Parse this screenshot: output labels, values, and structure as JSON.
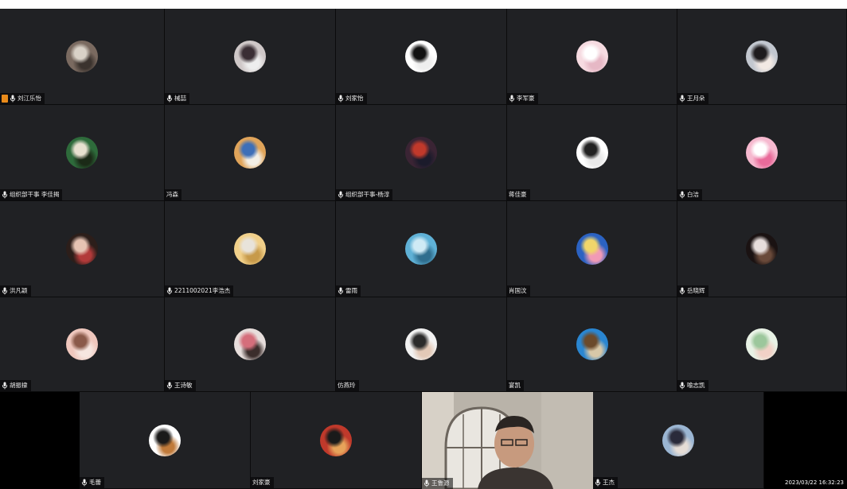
{
  "window": {
    "title": ""
  },
  "participants": [
    {
      "name": "刘江乐怡",
      "mic": true,
      "host": true,
      "avatar_colors": [
        "#7a6a60",
        "#d9d2c8",
        "#3b332e"
      ]
    },
    {
      "name": "械喆",
      "mic": true,
      "host": false,
      "avatar_colors": [
        "#cfc8c8",
        "#3a2e34",
        "#eee"
      ]
    },
    {
      "name": "刘家怡",
      "mic": true,
      "host": false,
      "avatar_colors": [
        "#ffffff",
        "#111111",
        "#eeeeee"
      ]
    },
    {
      "name": "李军豪",
      "mic": true,
      "host": false,
      "avatar_colors": [
        "#f6dbe1",
        "#ffffff",
        "#e6b8c5"
      ]
    },
    {
      "name": "王月朵",
      "mic": true,
      "host": false,
      "avatar_colors": [
        "#c2c7cf",
        "#1e1b1d",
        "#f2e9e4"
      ]
    },
    {
      "name": "组织部干事 李佳揭",
      "mic": true,
      "host": false,
      "avatar_colors": [
        "#2e6b3b",
        "#e8e1d0",
        "#1b2a17"
      ]
    },
    {
      "name": "冯森",
      "mic": false,
      "host": false,
      "avatar_colors": [
        "#e0a45a",
        "#3e6fb8",
        "#f3efe6"
      ]
    },
    {
      "name": "组织部干事-杨淳",
      "mic": true,
      "host": false,
      "avatar_colors": [
        "#3a2434",
        "#c0392b",
        "#1b1b2b"
      ]
    },
    {
      "name": "蒋佳豪",
      "mic": false,
      "host": false,
      "avatar_colors": [
        "#ffffff",
        "#222222",
        "#e9e9e9"
      ]
    },
    {
      "name": "白洁",
      "mic": true,
      "host": false,
      "avatar_colors": [
        "#f6b9cf",
        "#ffffff",
        "#e96b9a"
      ]
    },
    {
      "name": "洪凡颖",
      "mic": true,
      "host": false,
      "avatar_colors": [
        "#2c1e1a",
        "#e6c3b3",
        "#b23a3a"
      ]
    },
    {
      "name": "2211002021李浩杰",
      "mic": true,
      "host": false,
      "avatar_colors": [
        "#f1d08a",
        "#e8e3da",
        "#c79a4a"
      ]
    },
    {
      "name": "雷雨",
      "mic": true,
      "host": false,
      "avatar_colors": [
        "#5fb1d6",
        "#cfeaf5",
        "#2f6e8e"
      ]
    },
    {
      "name": "肖国汶",
      "mic": false,
      "host": false,
      "avatar_colors": [
        "#2b62c2",
        "#f0d66a",
        "#f19ab6"
      ]
    },
    {
      "name": "岳晓辉",
      "mic": true,
      "host": false,
      "avatar_colors": [
        "#1a1212",
        "#e7dedc",
        "#6a4a3a"
      ]
    },
    {
      "name": "胡振棣",
      "mic": true,
      "host": false,
      "avatar_colors": [
        "#efc7bd",
        "#8b5a4a",
        "#f6e6e0"
      ]
    },
    {
      "name": "王诗敏",
      "mic": true,
      "host": false,
      "avatar_colors": [
        "#e7dedc",
        "#d56e7b",
        "#3b2d2b"
      ]
    },
    {
      "name": "仿燕玲",
      "mic": false,
      "host": false,
      "avatar_colors": [
        "#f2f2f2",
        "#2b2b2b",
        "#e3c9b7"
      ]
    },
    {
      "name": "宴凯",
      "mic": false,
      "host": false,
      "avatar_colors": [
        "#2a86d1",
        "#6b4a2b",
        "#d8c8a8"
      ]
    },
    {
      "name": "喻志凯",
      "mic": true,
      "host": false,
      "avatar_colors": [
        "#e8f2e5",
        "#9cc79c",
        "#f1d1c6"
      ]
    }
  ],
  "bottom_participants": [
    {
      "name": "毛蕾",
      "mic": true,
      "avatar_colors": [
        "#ffffff",
        "#1a1a1a",
        "#c07a3a"
      ]
    },
    {
      "name": "刘家豪",
      "mic": false,
      "avatar_colors": [
        "#c0392b",
        "#1a1a1a",
        "#e7a35a"
      ]
    },
    {
      "name": "王鲁源",
      "mic": true,
      "camera": true
    },
    {
      "name": "王杰",
      "mic": true,
      "avatar_colors": [
        "#9bb6d3",
        "#2a2a3a",
        "#e6ddd6"
      ]
    }
  ],
  "timestamp": "2023/03/22 16:32:23",
  "colors": {
    "tile_bg": "#202124",
    "background": "#000000",
    "host_badge": "#e88a1a"
  },
  "icons": {
    "mic": "mic-icon",
    "host": "host-badge-icon"
  }
}
